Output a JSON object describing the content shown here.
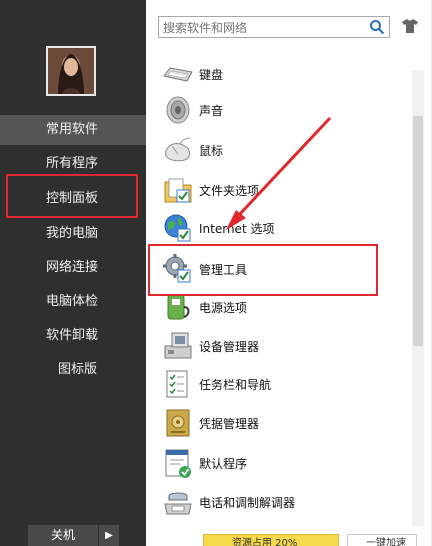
{
  "sidebar": {
    "items": [
      {
        "label": "常用软件"
      },
      {
        "label": "所有程序"
      },
      {
        "label": "控制面板"
      },
      {
        "label": "我的电脑"
      },
      {
        "label": "网络连接"
      },
      {
        "label": "电脑体检"
      },
      {
        "label": "软件卸载"
      },
      {
        "label": "图标版"
      }
    ],
    "shutdown_label": "关机",
    "shutdown_arrow": "▶"
  },
  "search": {
    "placeholder": "搜索软件和网络"
  },
  "items": [
    {
      "label": "键盘",
      "icon": "keyboard-icon"
    },
    {
      "label": "声音",
      "icon": "speaker-icon"
    },
    {
      "label": "鼠标",
      "icon": "mouse-icon"
    },
    {
      "label": "文件夹选项",
      "icon": "folder-options-icon"
    },
    {
      "label": "Internet 选项",
      "icon": "internet-options-icon"
    },
    {
      "label": "管理工具",
      "icon": "admin-tools-icon"
    },
    {
      "label": "电源选项",
      "icon": "power-options-icon"
    },
    {
      "label": "设备管理器",
      "icon": "device-manager-icon"
    },
    {
      "label": "任务栏和导航",
      "icon": "taskbar-icon"
    },
    {
      "label": "凭据管理器",
      "icon": "credential-manager-icon"
    },
    {
      "label": "默认程序",
      "icon": "default-programs-icon"
    },
    {
      "label": "电话和调制解调器",
      "icon": "phone-modem-icon"
    }
  ],
  "bottom": {
    "left_label": "资源占用 20%",
    "right_label": "一键加速"
  },
  "colors": {
    "sidebar_bg": "#2f2f2f",
    "active_bg": "#555555",
    "highlight_red": "#e0282d",
    "accent_yellow": "#f7d94c"
  }
}
